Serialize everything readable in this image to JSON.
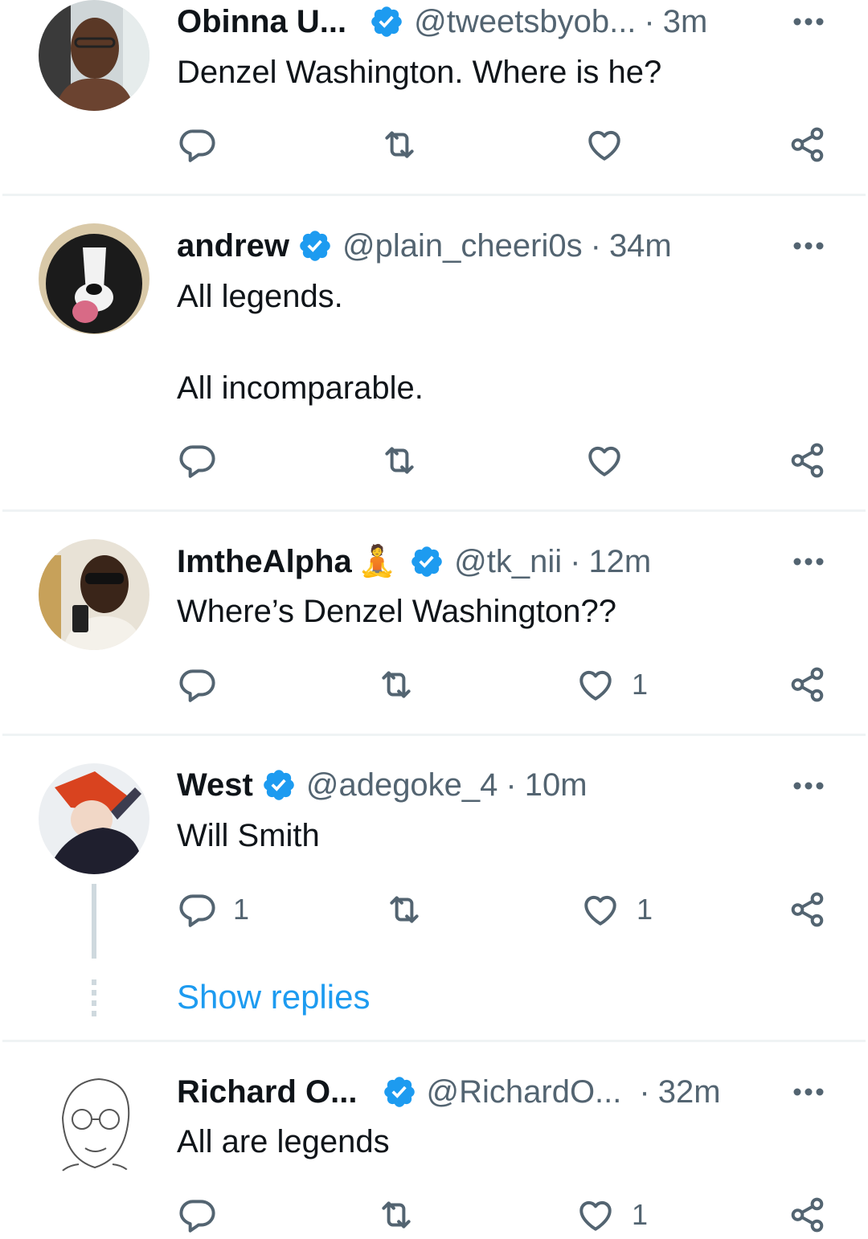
{
  "replies": [
    {
      "name": "Obinna U...",
      "handle": "@tweetsbyob...",
      "time": "3m",
      "text": "Denzel Washington. Where is he?",
      "reply_count": "",
      "like_count": ""
    },
    {
      "name": "andrew",
      "handle": "@plain_cheeri0s",
      "time": "34m",
      "text": "All legends.\n\nAll incomparable.",
      "reply_count": "",
      "like_count": ""
    },
    {
      "name": "ImtheAlpha",
      "name_emoji": "🧘",
      "handle": "@tk_nii",
      "time": "12m",
      "text": "Where’s Denzel Washington??",
      "reply_count": "",
      "like_count": "1"
    },
    {
      "name": "West",
      "handle": "@adegoke_4",
      "time": "10m",
      "text": "Will Smith",
      "reply_count": "1",
      "like_count": "1",
      "show_replies_label": "Show replies"
    },
    {
      "name": "Richard O...",
      "handle": "@RichardO...",
      "time": "32m",
      "text": "All are legends",
      "reply_count": "",
      "like_count": "1"
    }
  ],
  "separator": "·",
  "icons": {
    "verified": "verified-badge-icon",
    "more": "more-options-icon",
    "reply": "reply-icon",
    "retweet": "retweet-icon",
    "like": "like-icon",
    "share": "share-icon"
  },
  "colors": {
    "verified": "#1d9bf0",
    "link": "#1d9bf0",
    "secondary_text": "#536471",
    "divider": "#eff3f4"
  }
}
